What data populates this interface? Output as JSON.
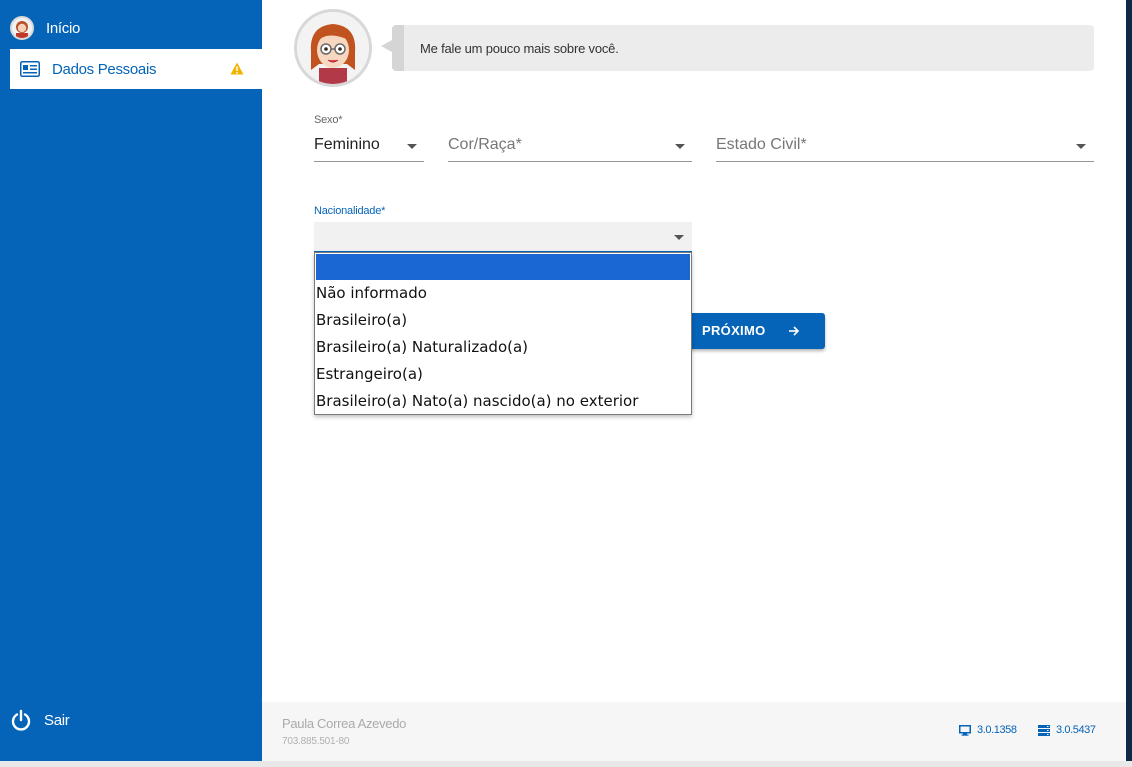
{
  "sidebar": {
    "home_label": "Início",
    "dados_label": "Dados Pessoais",
    "logout_label": "Sair"
  },
  "assistant": {
    "message": "Me fale um pouco mais sobre você."
  },
  "form": {
    "sexo": {
      "label": "Sexo*",
      "value": "Feminino"
    },
    "cor": {
      "placeholder": "Cor/Raça*"
    },
    "estado_civil": {
      "placeholder": "Estado Civil*"
    },
    "nacionalidade": {
      "label": "Nacionalidade*",
      "value": "",
      "options": [
        "",
        "Não informado",
        "Brasileiro(a)",
        "Brasileiro(a) Naturalizado(a)",
        "Estrangeiro(a)",
        "Brasileiro(a) Nato(a) nascido(a) no exterior"
      ]
    }
  },
  "buttons": {
    "next_label": "PRÓXIMO"
  },
  "footer": {
    "user_name": "Paula Correa Azevedo",
    "user_id": "703.885.501-80",
    "client_version": "3.0.1358",
    "server_version": "3.0.5437"
  },
  "colors": {
    "primary": "#0564b8",
    "selected_option": "#1a66d2",
    "warning": "#f0b400"
  },
  "icons": {
    "home": "avatar-icon",
    "dados": "id-card-icon",
    "warning": "warning-icon",
    "logout": "power-icon",
    "next": "arrow-right-icon",
    "client": "monitor-icon",
    "server": "server-icon"
  }
}
